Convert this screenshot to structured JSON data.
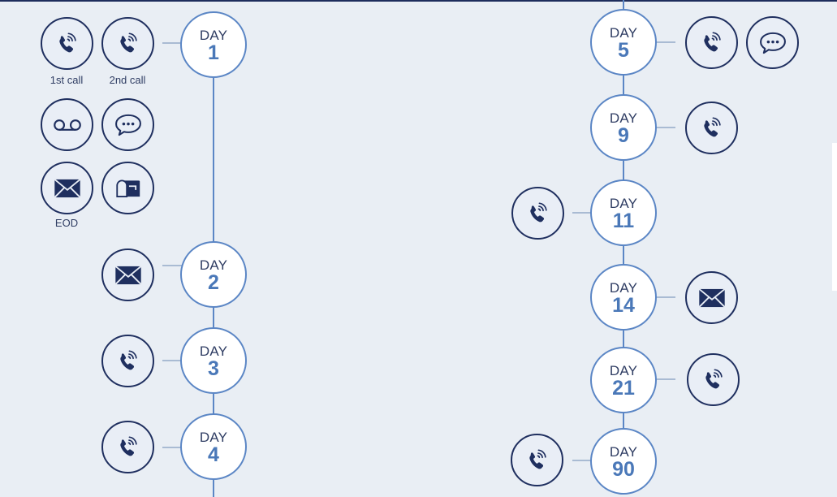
{
  "colors": {
    "background": "#e9eef4",
    "top_bar": "#1e2d5c",
    "timeline_line": "#5b86c5",
    "connector": "#a9bbd3",
    "day_label": "#2f3d63",
    "day_number": "#4a78b8",
    "icon": "#1f2f5f"
  },
  "day_label": "DAY",
  "legend": {
    "items": [
      {
        "icon": "phone-icon",
        "caption": "1st call"
      },
      {
        "icon": "phone-icon",
        "caption": "2nd call"
      },
      {
        "icon": "voicemail-icon",
        "caption": ""
      },
      {
        "icon": "chat-bubble-icon",
        "caption": ""
      },
      {
        "icon": "email-icon",
        "caption": "EOD"
      },
      {
        "icon": "mailbox-icon",
        "caption": ""
      }
    ]
  },
  "timeline": [
    {
      "day": "1",
      "actions": []
    },
    {
      "day": "2",
      "actions": [
        "email-icon"
      ]
    },
    {
      "day": "3",
      "actions": [
        "phone-icon"
      ]
    },
    {
      "day": "4",
      "actions": [
        "phone-icon"
      ]
    },
    {
      "day": "5",
      "actions": [
        "phone-icon",
        "chat-bubble-icon"
      ]
    },
    {
      "day": "9",
      "actions": [
        "phone-icon"
      ]
    },
    {
      "day": "11",
      "actions": [
        "phone-icon"
      ]
    },
    {
      "day": "14",
      "actions": [
        "email-icon"
      ]
    },
    {
      "day": "21",
      "actions": [
        "phone-icon"
      ]
    },
    {
      "day": "90",
      "actions": [
        "phone-icon"
      ]
    }
  ]
}
